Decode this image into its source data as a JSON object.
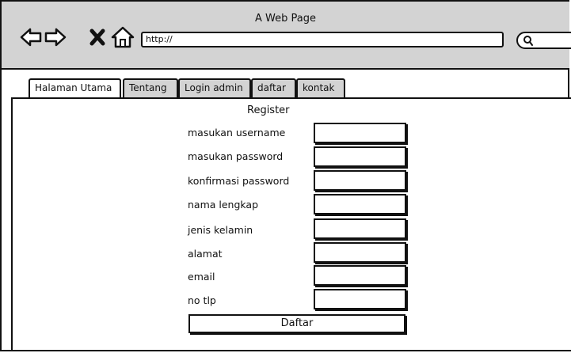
{
  "browser": {
    "title": "A Web Page",
    "url": "http://"
  },
  "tabs": [
    {
      "label": "Halaman Utama"
    },
    {
      "label": "Tentang"
    },
    {
      "label": "Login admin"
    },
    {
      "label": "daftar"
    },
    {
      "label": "kontak"
    }
  ],
  "form": {
    "title": "Register",
    "fields": [
      {
        "label": "masukan username",
        "value": ""
      },
      {
        "label": "masukan password",
        "value": ""
      },
      {
        "label": "konfirmasi password",
        "value": ""
      },
      {
        "label": "nama lengkap",
        "value": ""
      },
      {
        "label": "jenis kelamin",
        "value": ""
      },
      {
        "label": "alamat",
        "value": ""
      },
      {
        "label": "email",
        "value": ""
      },
      {
        "label": "no tlp",
        "value": ""
      }
    ],
    "submit_label": "Daftar"
  }
}
